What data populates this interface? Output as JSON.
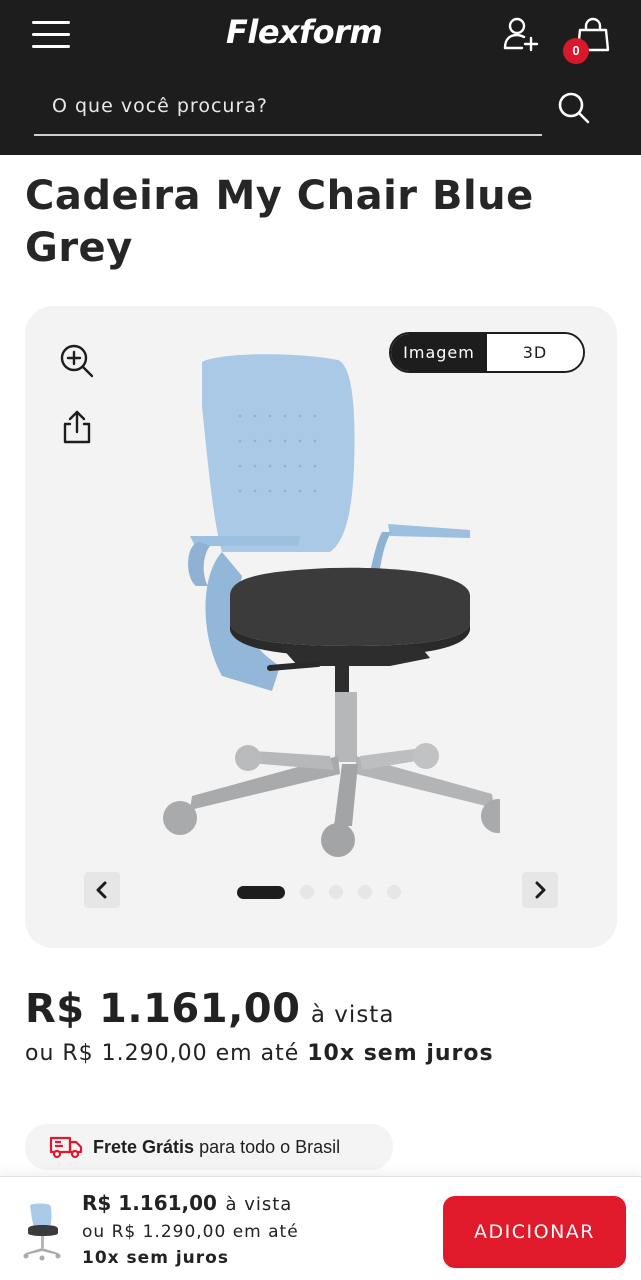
{
  "header": {
    "logo_text": "Flexform",
    "cart_count": "0",
    "search": {
      "placeholder": "O que você procura?"
    },
    "menu_icon": "hamburger-icon",
    "user_icon": "user-add-icon",
    "cart_icon": "shopping-bag-icon",
    "search_icon": "search-icon",
    "background_color": "#1d1d1d",
    "badge_color": "#d7192b"
  },
  "product": {
    "title": "Cadeira My Chair Blue Grey",
    "seat_color": "#3b3b3b",
    "shell_color": "#a9c9e6"
  },
  "gallery": {
    "view_options": [
      "Imagem",
      "3D"
    ],
    "selected_view": "Imagem",
    "image_count": 5,
    "active_index": 0,
    "zoom_icon": "zoom-in-icon",
    "share_icon": "share-icon",
    "prev_icon": "chevron-left-icon",
    "next_icon": "chevron-right-icon"
  },
  "pricing": {
    "cash_price": "R$ 1.161,00",
    "cash_suffix": "à vista",
    "installment_prefix": "ou R$ 1.290,00 em até",
    "installment_terms": "10x sem juros"
  },
  "shipping": {
    "highlight": "Frete Grátis",
    "text": "para todo o Brasil",
    "icon": "truck-icon"
  },
  "sticky_bar": {
    "price": "R$ 1.161,00",
    "price_suffix": "à vista",
    "installment_prefix": "ou R$ 1.290,00 em até",
    "installment_terms": "10x sem juros",
    "button_label": "ADICIONAR",
    "button_color": "#e01a2b"
  }
}
